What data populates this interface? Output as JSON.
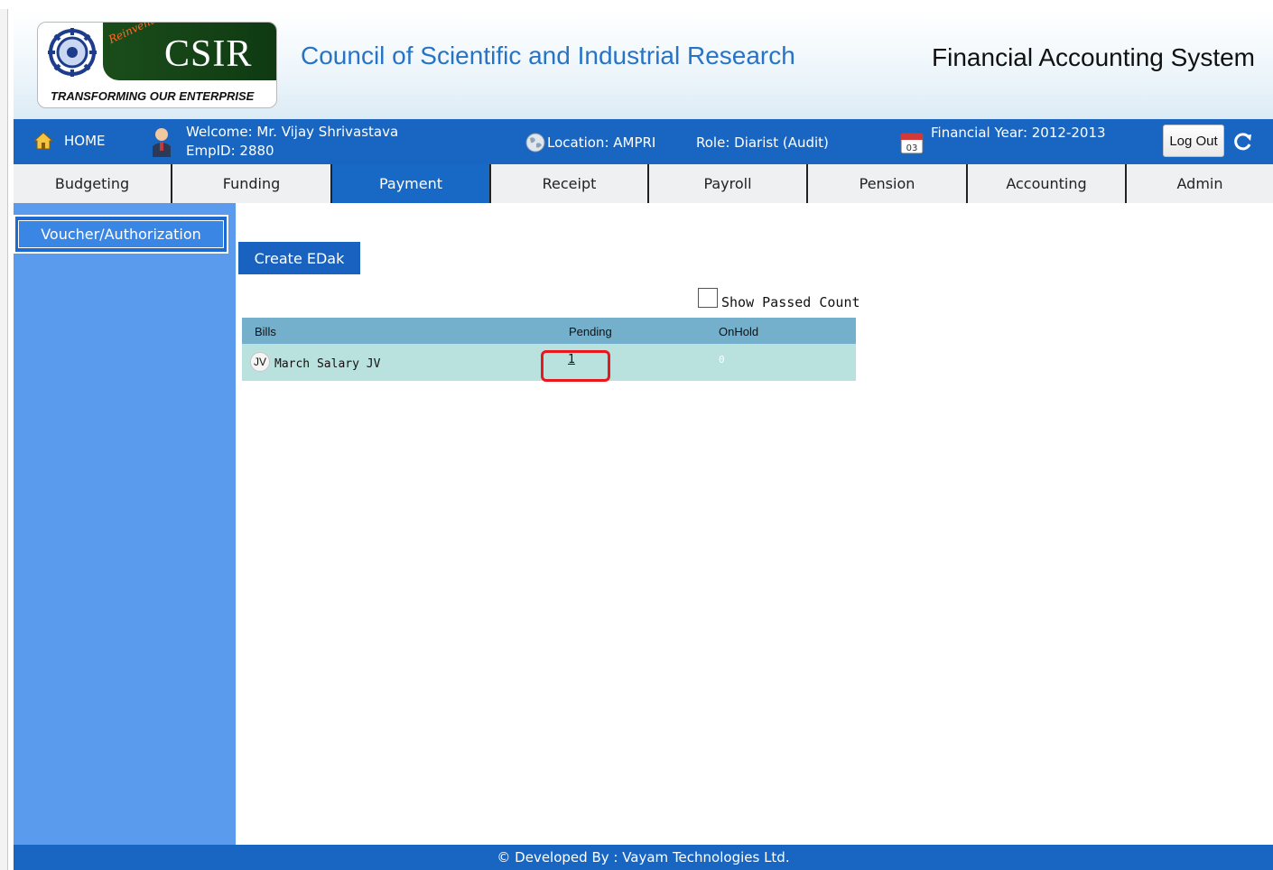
{
  "header": {
    "logo_reinventing": "Reinventing",
    "logo_text": "CSIR",
    "logo_tagline": "TRANSFORMING OUR ENTERPRISE",
    "org_title": "Council of Scientific and Industrial Research",
    "system_title": "Financial Accounting System"
  },
  "infobar": {
    "home_label": "HOME",
    "welcome": "Welcome: Mr. Vijay Shrivastava",
    "empid": "EmpID: 2880",
    "location": "Location: AMPRI",
    "role": "Role: Diarist (Audit)",
    "calendar_day": "03",
    "financial_year": "Financial Year: 2012-2013",
    "logout_label": "Log Out"
  },
  "menu": {
    "items": [
      {
        "label": "Budgeting",
        "active": false
      },
      {
        "label": "Funding",
        "active": false
      },
      {
        "label": "Payment",
        "active": true
      },
      {
        "label": "Receipt",
        "active": false
      },
      {
        "label": "Payroll",
        "active": false
      },
      {
        "label": "Pension",
        "active": false
      },
      {
        "label": "Accounting",
        "active": false
      },
      {
        "label": "Admin",
        "active": false
      }
    ]
  },
  "sidebar": {
    "items": [
      {
        "label": "Voucher/Authorization"
      }
    ]
  },
  "content": {
    "create_button": "Create EDak",
    "show_passed_label": "Show Passed Count",
    "show_passed_checked": false,
    "table": {
      "headers": [
        "Bills",
        "Pending",
        "OnHold"
      ],
      "rows": [
        {
          "badge": "JV",
          "bill": "March Salary JV",
          "pending": "1",
          "onhold": "0"
        }
      ]
    }
  },
  "footer": {
    "text": "© Developed By : Vayam Technologies Ltd."
  },
  "colors": {
    "primary_blue": "#1966c2",
    "sidebar_blue": "#5b9bed",
    "table_header": "#74b0cc",
    "table_row": "#b9e2df",
    "highlight_red": "#e8181e",
    "logo_green": "#1b4d1b"
  }
}
